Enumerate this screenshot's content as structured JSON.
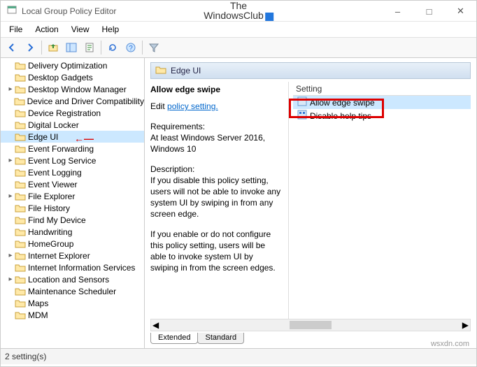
{
  "window": {
    "title": "Local Group Policy Editor",
    "logo_line1": "The",
    "logo_line2": "WindowsClub"
  },
  "menu": {
    "items": [
      "File",
      "Action",
      "View",
      "Help"
    ]
  },
  "tree": {
    "items": [
      {
        "label": "Delivery Optimization",
        "exp": false
      },
      {
        "label": "Desktop Gadgets",
        "exp": false
      },
      {
        "label": "Desktop Window Manager",
        "exp": true
      },
      {
        "label": "Device and Driver Compatibility",
        "exp": false
      },
      {
        "label": "Device Registration",
        "exp": false
      },
      {
        "label": "Digital Locker",
        "exp": false
      },
      {
        "label": "Edge UI",
        "exp": false,
        "selected": true,
        "arrow": true
      },
      {
        "label": "Event Forwarding",
        "exp": false
      },
      {
        "label": "Event Log Service",
        "exp": true
      },
      {
        "label": "Event Logging",
        "exp": false
      },
      {
        "label": "Event Viewer",
        "exp": false
      },
      {
        "label": "File Explorer",
        "exp": true
      },
      {
        "label": "File History",
        "exp": false
      },
      {
        "label": "Find My Device",
        "exp": false
      },
      {
        "label": "Handwriting",
        "exp": false
      },
      {
        "label": "HomeGroup",
        "exp": false
      },
      {
        "label": "Internet Explorer",
        "exp": true
      },
      {
        "label": "Internet Information Services",
        "exp": false
      },
      {
        "label": "Location and Sensors",
        "exp": true
      },
      {
        "label": "Maintenance Scheduler",
        "exp": false
      },
      {
        "label": "Maps",
        "exp": false
      },
      {
        "label": "MDM",
        "exp": false
      }
    ]
  },
  "header": {
    "category": "Edge UI"
  },
  "detail": {
    "title": "Allow edge swipe",
    "edit_prefix": "Edit ",
    "edit_link": "policy setting.",
    "req_label": "Requirements:",
    "req_text": "At least Windows Server 2016, Windows 10",
    "desc_label": "Description:",
    "desc1": "If you disable this policy setting, users will not be able to invoke any system UI by swiping in from any screen edge.",
    "desc2": "If you enable or do not configure this policy setting, users will be able to invoke system UI by swiping in from the screen edges."
  },
  "settings": {
    "column": "Setting",
    "rows": [
      {
        "label": "Allow edge swipe",
        "selected": true
      },
      {
        "label": "Disable help tips",
        "selected": false
      }
    ]
  },
  "tabs": {
    "extended": "Extended",
    "standard": "Standard"
  },
  "status": {
    "text": "2 setting(s)"
  },
  "watermark": "wsxdn.com"
}
